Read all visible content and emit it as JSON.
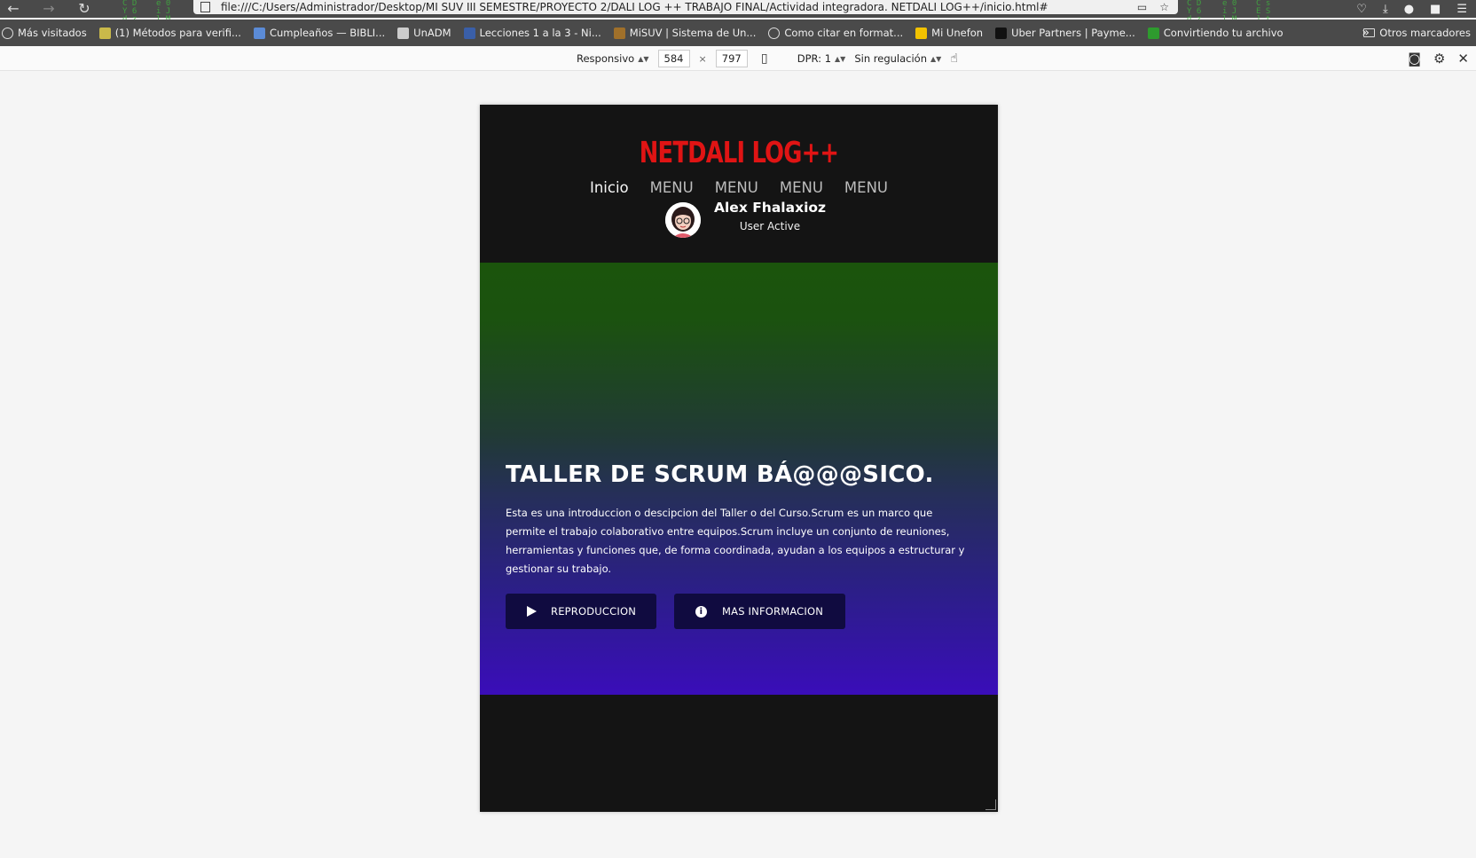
{
  "browser": {
    "url": "file:///C:/Users/Administrador/Desktop/MI SUV III SEMESTRE/PROYECTO 2/DALI LOG ++ TRABAJO FINAL/Actividad integradora. NETDALI LOG++/inicio.html#"
  },
  "bookmarks": {
    "items": [
      {
        "label": "Más visitados",
        "icon": "gear-icon",
        "color": "#dddddd"
      },
      {
        "label": "(1) Métodos para verifi...",
        "icon": "bookmark-icon",
        "color": "#c9b94a"
      },
      {
        "label": "Cumpleaños — BIBLI...",
        "icon": "bookmark-icon",
        "color": "#5b8bd6"
      },
      {
        "label": "UnADM",
        "icon": "bookmark-icon",
        "color": "#cccccc"
      },
      {
        "label": "Lecciones 1 a la 3 - Ni...",
        "icon": "bookmark-icon",
        "color": "#3a5fa8"
      },
      {
        "label": "MiSUV | Sistema de Un...",
        "icon": "bookmark-icon",
        "color": "#a0702a"
      },
      {
        "label": "Como citar en format...",
        "icon": "globe-icon",
        "color": "#dddddd"
      },
      {
        "label": "Mi Unefon",
        "icon": "bookmark-icon",
        "color": "#f2c200"
      },
      {
        "label": "Uber Partners | Payme...",
        "icon": "bookmark-icon",
        "color": "#111111"
      },
      {
        "label": "Convirtiendo tu archivo",
        "icon": "bookmark-icon",
        "color": "#2e9b2e"
      }
    ],
    "more": "»",
    "other": "Otros marcadores"
  },
  "rdm": {
    "device": "Responsivo",
    "width": "584",
    "height": "797",
    "times": "×",
    "dpr": "DPR: 1",
    "throttle": "Sin regulación"
  },
  "site": {
    "brand": "NETDALI LOG++",
    "nav": [
      {
        "label": "Inicio"
      },
      {
        "label": "MENU"
      },
      {
        "label": "MENU"
      },
      {
        "label": "MENU"
      },
      {
        "label": "MENU"
      }
    ],
    "user": {
      "name": "Alex Fhalaxioz",
      "status": "User Active"
    },
    "hero": {
      "title": "TALLER DE SCRUM BÁ@@@SICO.",
      "description": "Esta es una introduccion o descipcion del Taller o del Curso.Scrum es un marco que permite el trabajo colaborativo entre equipos.Scrum incluye un conjunto de reuniones, herramientas y funciones que, de forma coordinada, ayudan a los equipos a estructurar y gestionar su trabajo.",
      "play_label": "REPRODUCCION",
      "info_label": "MAS INFORMACION"
    },
    "colors": {
      "brand": "#e01414",
      "button": "#100b40",
      "hero_top": "#1b540c",
      "hero_bottom": "#3a0db9"
    }
  }
}
